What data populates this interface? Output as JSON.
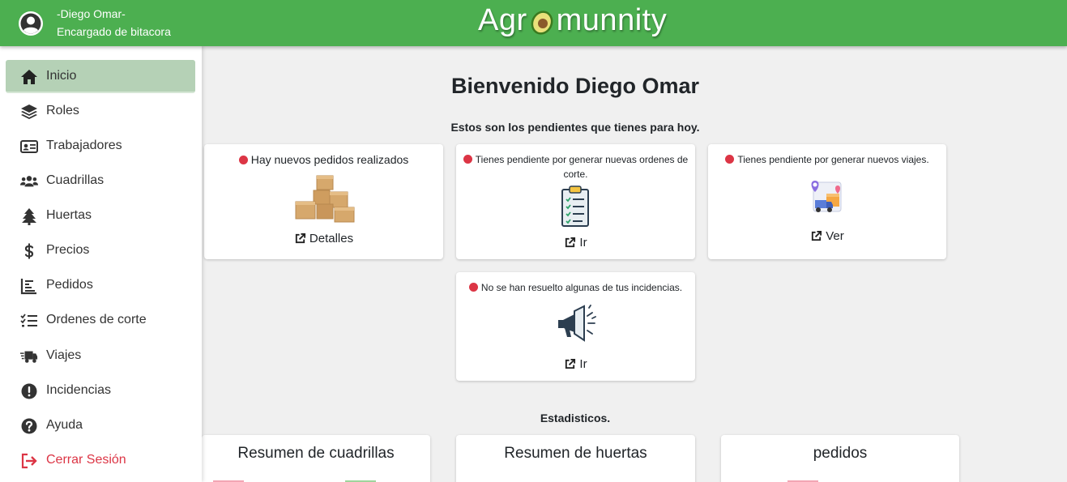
{
  "user": {
    "name": "-Diego Omar-",
    "role": "Encargado de bitacora",
    "icon": "user-circle-icon"
  },
  "brand": {
    "before": "Agr",
    "after": "munnity",
    "accent": "#4caf50"
  },
  "sidebar": {
    "items": [
      {
        "label": "Inicio",
        "icon": "home-icon"
      },
      {
        "label": "Roles",
        "icon": "layers-icon"
      },
      {
        "label": "Trabajadores",
        "icon": "id-card-icon"
      },
      {
        "label": "Cuadrillas",
        "icon": "users-icon"
      },
      {
        "label": "Huertas",
        "icon": "tree-icon"
      },
      {
        "label": "Precios",
        "icon": "dollar-icon"
      },
      {
        "label": "Pedidos",
        "icon": "chart-icon"
      },
      {
        "label": "Ordenes de corte",
        "icon": "checklist-icon"
      },
      {
        "label": "Viajes",
        "icon": "truck-icon"
      },
      {
        "label": "Incidencias",
        "icon": "exclamation-icon"
      },
      {
        "label": "Ayuda",
        "icon": "question-icon"
      },
      {
        "label": "Cerrar Sesión",
        "icon": "logout-icon"
      }
    ]
  },
  "main": {
    "welcome": "Bienvenido Diego Omar",
    "subtitle": "Estos son los pendientes que tienes para hoy.",
    "cards": [
      {
        "message": "Hay nuevos pedidos realizados",
        "link": "Detalles",
        "image": "boxes-image"
      },
      {
        "message": "Tienes pendiente por generar nuevas ordenes de corte.",
        "link": "Ir",
        "image": "clipboard-image"
      },
      {
        "message": "Tienes pendiente por generar nuevos viajes.",
        "link": "Ver",
        "image": "delivery-map-image"
      },
      {
        "message": "No se han resuelto algunas de tus incidencias.",
        "link": "Ir",
        "image": "megaphone-image"
      }
    ],
    "stats_title": "Estadisticos.",
    "stat_cards": [
      {
        "title": "Resumen de cuadrillas"
      },
      {
        "title": "Resumen de huertas"
      },
      {
        "title": "pedidos"
      }
    ]
  }
}
